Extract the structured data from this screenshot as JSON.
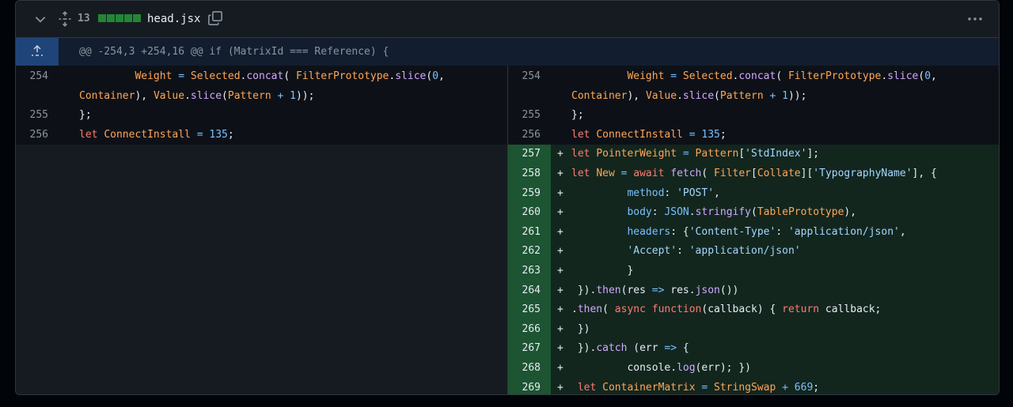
{
  "file": {
    "changes_count": "13",
    "name": "head.jsx",
    "diffstat_blocks": 5,
    "accent": "#238636"
  },
  "hunk": {
    "header": "@@ -254,3 +254,16 @@ if (MatrixId === Reference) {"
  },
  "left": {
    "lines": [
      {
        "num": "254",
        "tokens": [
          [
            "p",
            "         "
          ],
          [
            "v",
            "Weight"
          ],
          [
            "p",
            " "
          ],
          [
            "n",
            "="
          ],
          [
            "p",
            " "
          ],
          [
            "v",
            "Selected"
          ],
          [
            "p",
            "."
          ],
          [
            "f",
            "concat"
          ],
          [
            "p",
            "( "
          ],
          [
            "v",
            "FilterPrototype"
          ],
          [
            "p",
            "."
          ],
          [
            "f",
            "slice"
          ],
          [
            "p",
            "("
          ],
          [
            "n",
            "0"
          ],
          [
            "p",
            ","
          ]
        ]
      },
      {
        "num": "",
        "tokens": [
          [
            "v",
            "Container"
          ],
          [
            "p",
            "), "
          ],
          [
            "v",
            "Value"
          ],
          [
            "p",
            "."
          ],
          [
            "f",
            "slice"
          ],
          [
            "p",
            "("
          ],
          [
            "v",
            "Pattern"
          ],
          [
            "p",
            " "
          ],
          [
            "n",
            "+"
          ],
          [
            "p",
            " "
          ],
          [
            "n",
            "1"
          ],
          [
            "p",
            "));"
          ]
        ]
      },
      {
        "num": "255",
        "tokens": [
          [
            "p",
            "};"
          ]
        ]
      },
      {
        "num": "256",
        "tokens": [
          [
            "k",
            "let"
          ],
          [
            "p",
            " "
          ],
          [
            "v",
            "ConnectInstall"
          ],
          [
            "p",
            " "
          ],
          [
            "n",
            "="
          ],
          [
            "p",
            " "
          ],
          [
            "n",
            "135"
          ],
          [
            "p",
            ";"
          ]
        ]
      }
    ]
  },
  "right": {
    "lines": [
      {
        "num": "254",
        "add": false,
        "tokens": [
          [
            "p",
            "         "
          ],
          [
            "v",
            "Weight"
          ],
          [
            "p",
            " "
          ],
          [
            "n",
            "="
          ],
          [
            "p",
            " "
          ],
          [
            "v",
            "Selected"
          ],
          [
            "p",
            "."
          ],
          [
            "f",
            "concat"
          ],
          [
            "p",
            "( "
          ],
          [
            "v",
            "FilterPrototype"
          ],
          [
            "p",
            "."
          ],
          [
            "f",
            "slice"
          ],
          [
            "p",
            "("
          ],
          [
            "n",
            "0"
          ],
          [
            "p",
            ","
          ]
        ]
      },
      {
        "num": "",
        "add": false,
        "tokens": [
          [
            "v",
            "Container"
          ],
          [
            "p",
            "), "
          ],
          [
            "v",
            "Value"
          ],
          [
            "p",
            "."
          ],
          [
            "f",
            "slice"
          ],
          [
            "p",
            "("
          ],
          [
            "v",
            "Pattern"
          ],
          [
            "p",
            " "
          ],
          [
            "n",
            "+"
          ],
          [
            "p",
            " "
          ],
          [
            "n",
            "1"
          ],
          [
            "p",
            "));"
          ]
        ]
      },
      {
        "num": "255",
        "add": false,
        "tokens": [
          [
            "p",
            "};"
          ]
        ]
      },
      {
        "num": "256",
        "add": false,
        "tokens": [
          [
            "k",
            "let"
          ],
          [
            "p",
            " "
          ],
          [
            "v",
            "ConnectInstall"
          ],
          [
            "p",
            " "
          ],
          [
            "n",
            "="
          ],
          [
            "p",
            " "
          ],
          [
            "n",
            "135"
          ],
          [
            "p",
            ";"
          ]
        ]
      },
      {
        "num": "257",
        "add": true,
        "tokens": [
          [
            "k",
            "let"
          ],
          [
            "p",
            " "
          ],
          [
            "v",
            "PointerWeight"
          ],
          [
            "p",
            " "
          ],
          [
            "n",
            "="
          ],
          [
            "p",
            " "
          ],
          [
            "v",
            "Pattern"
          ],
          [
            "p",
            "["
          ],
          [
            "s",
            "'StdIndex'"
          ],
          [
            "p",
            "];"
          ]
        ]
      },
      {
        "num": "258",
        "add": true,
        "tokens": [
          [
            "k",
            "let"
          ],
          [
            "p",
            " "
          ],
          [
            "v",
            "New"
          ],
          [
            "p",
            " "
          ],
          [
            "n",
            "="
          ],
          [
            "p",
            " "
          ],
          [
            "k",
            "await"
          ],
          [
            "p",
            " "
          ],
          [
            "f",
            "fetch"
          ],
          [
            "p",
            "( "
          ],
          [
            "v",
            "Filter"
          ],
          [
            "p",
            "["
          ],
          [
            "v",
            "Collate"
          ],
          [
            "p",
            "]["
          ],
          [
            "s",
            "'TypographyName'"
          ],
          [
            "p",
            "], {"
          ]
        ]
      },
      {
        "num": "259",
        "add": true,
        "tokens": [
          [
            "p",
            "         "
          ],
          [
            "n",
            "method"
          ],
          [
            "p",
            ": "
          ],
          [
            "s",
            "'POST'"
          ],
          [
            "p",
            ","
          ]
        ]
      },
      {
        "num": "260",
        "add": true,
        "tokens": [
          [
            "p",
            "         "
          ],
          [
            "n",
            "body"
          ],
          [
            "p",
            ": "
          ],
          [
            "n",
            "JSON"
          ],
          [
            "p",
            "."
          ],
          [
            "f",
            "stringify"
          ],
          [
            "p",
            "("
          ],
          [
            "v",
            "TablePrototype"
          ],
          [
            "p",
            "),"
          ]
        ]
      },
      {
        "num": "261",
        "add": true,
        "tokens": [
          [
            "p",
            "         "
          ],
          [
            "n",
            "headers"
          ],
          [
            "p",
            ": {"
          ],
          [
            "s",
            "'Content-Type'"
          ],
          [
            "p",
            ": "
          ],
          [
            "s",
            "'application/json'"
          ],
          [
            "p",
            ","
          ]
        ]
      },
      {
        "num": "262",
        "add": true,
        "tokens": [
          [
            "p",
            "         "
          ],
          [
            "s",
            "'Accept'"
          ],
          [
            "p",
            ": "
          ],
          [
            "s",
            "'application/json'"
          ]
        ]
      },
      {
        "num": "263",
        "add": true,
        "tokens": [
          [
            "p",
            "         }"
          ]
        ]
      },
      {
        "num": "264",
        "add": true,
        "tokens": [
          [
            "p",
            " })."
          ],
          [
            "f",
            "then"
          ],
          [
            "p",
            "(res "
          ],
          [
            "n",
            "=>"
          ],
          [
            "p",
            " res."
          ],
          [
            "f",
            "json"
          ],
          [
            "p",
            "())"
          ]
        ]
      },
      {
        "num": "265",
        "add": true,
        "tokens": [
          [
            "p",
            "."
          ],
          [
            "f",
            "then"
          ],
          [
            "p",
            "( "
          ],
          [
            "k",
            "async"
          ],
          [
            "p",
            " "
          ],
          [
            "k",
            "function"
          ],
          [
            "p",
            "(callback) { "
          ],
          [
            "k",
            "return"
          ],
          [
            "p",
            " callback;"
          ]
        ]
      },
      {
        "num": "266",
        "add": true,
        "tokens": [
          [
            "p",
            " })"
          ]
        ]
      },
      {
        "num": "267",
        "add": true,
        "tokens": [
          [
            "p",
            " })."
          ],
          [
            "f",
            "catch"
          ],
          [
            "p",
            " (err "
          ],
          [
            "n",
            "=>"
          ],
          [
            "p",
            " {"
          ]
        ]
      },
      {
        "num": "268",
        "add": true,
        "tokens": [
          [
            "p",
            "         console."
          ],
          [
            "f",
            "log"
          ],
          [
            "p",
            "(err); })"
          ]
        ]
      },
      {
        "num": "269",
        "add": true,
        "tokens": [
          [
            "p",
            " "
          ],
          [
            "k",
            "let"
          ],
          [
            "p",
            " "
          ],
          [
            "v",
            "ContainerMatrix"
          ],
          [
            "p",
            " "
          ],
          [
            "n",
            "="
          ],
          [
            "p",
            " "
          ],
          [
            "v",
            "StringSwap"
          ],
          [
            "p",
            " "
          ],
          [
            "n",
            "+"
          ],
          [
            "p",
            " "
          ],
          [
            "n",
            "669"
          ],
          [
            "p",
            ";"
          ]
        ]
      }
    ]
  },
  "add_marker": "+"
}
